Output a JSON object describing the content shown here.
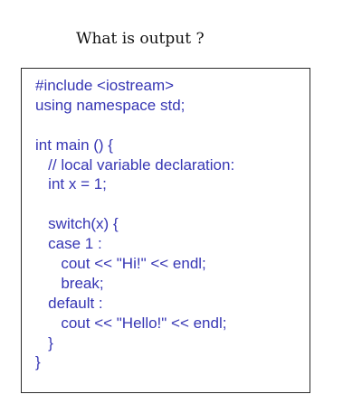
{
  "question": "What is output ?",
  "code_lines": [
    "#include <iostream>",
    "using namespace std;",
    "",
    "int main () {",
    "   // local variable declaration:",
    "   int x = 1;",
    "",
    "   switch(x) {",
    "   case 1 :",
    "      cout << \"Hi!\" << endl;",
    "      break;",
    "   default :",
    "      cout << \"Hello!\" << endl;",
    "   }",
    "}"
  ],
  "colors": {
    "code_text": "#3636b4",
    "question_text": "#111111",
    "box_border": "#2b2b2b"
  }
}
